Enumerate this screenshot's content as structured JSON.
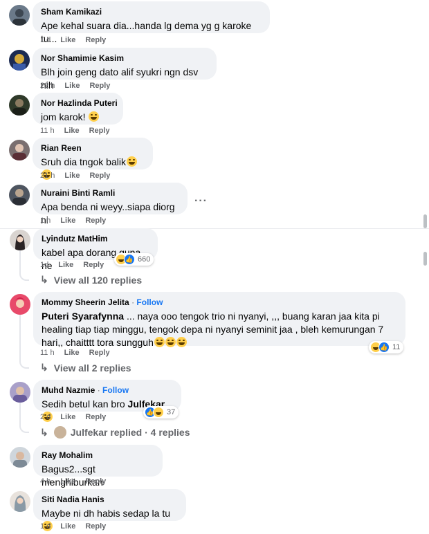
{
  "colors": {
    "bubble": "#f0f2f5",
    "meta": "#65676b",
    "link": "#1877f2",
    "like_blue": "#1877f2",
    "haha_yellow": "#ffcf4b"
  },
  "actions": {
    "like": "Like",
    "reply": "Reply",
    "follow": "Follow"
  },
  "comments": [
    {
      "name": "Sham Kamikazi",
      "text": "Ape kehal suara dia...handa lg dema yg g karoke tu...",
      "time": "1 d"
    },
    {
      "name": "Nor Shamimie Kasim",
      "text": "Blh join geng dato alif syukri ngn dsv nih",
      "time": "22 h"
    },
    {
      "name": "Nor Hazlinda Puteri",
      "text": "jom karok!",
      "emoji": "laughing-emoji",
      "time": "11 h"
    },
    {
      "name": "Rian Reen",
      "text": "Sruh dia tngok balik",
      "emoji": "grin-emoji",
      "time": "21 h"
    },
    {
      "name": "Nuraini Binti Ramli",
      "text": "Apa benda ni weyy..siapa diorg ni",
      "time": "1 h",
      "more_icon": "more-dots-icon"
    },
    {
      "name": "Lyindutz MatHim",
      "text": "kabel apa dorang guna ne",
      "time": "1d",
      "reaction_count": "660",
      "view_replies": "View all 120 replies"
    },
    {
      "name": "Mommy Sheerin Jelita",
      "follow": true,
      "mention": "Puteri Syarafynna",
      "text": " ... naya ooo tengok trio ni nyanyi, ,,, buang karan jaa kita pi healing tiap tiap minggu, tengok depa ni nyanyi seminit jaa , bleh kemurungan 7 hari,, chaitttt tora sungguh",
      "emoji": "rofl-emoji",
      "time": "11 h",
      "reaction_count": "11",
      "view_replies": "View all 2 replies"
    },
    {
      "name": "Muhd Nazmie",
      "follow": true,
      "text": "Sedih betul kan bro ",
      "mention": "Julfekar",
      "emoji": "smile-emoji",
      "time": "2 d",
      "reaction_count": "37",
      "replied_text": "Julfekar replied · 4 replies"
    },
    {
      "name": "Ray Mohalim",
      "text": "Bagus2...sgt menghiburkan",
      "time": "4 h"
    },
    {
      "name": "Siti Nadia Hanis",
      "text": "Maybe ni dh habis sedap la tu",
      "emoji": "smile-emoji",
      "time": "1 d"
    }
  ]
}
